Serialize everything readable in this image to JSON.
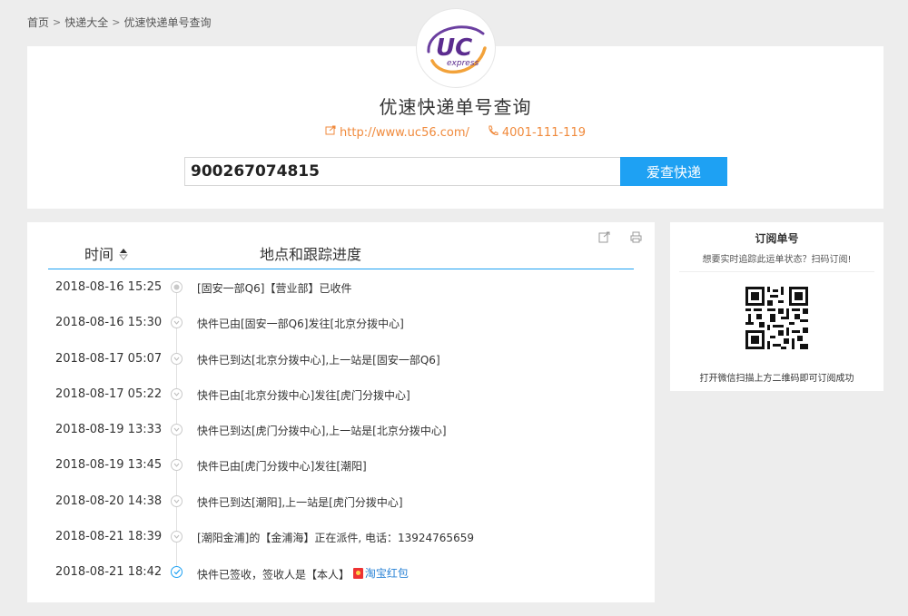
{
  "breadcrumb": {
    "home": "首页",
    "express_all": "快递大全",
    "current": "优速快递单号查询",
    "separator": ">"
  },
  "header": {
    "logo_text": "UC",
    "logo_sub": "express",
    "title": "优速快递单号查询",
    "website": "http://www.uc56.com/",
    "phone": "4001-111-119",
    "website_icon": "link-icon",
    "phone_icon": "phone-icon",
    "accent_color": "#f08a3c"
  },
  "search": {
    "value": "900267074815",
    "button_label": "爱查快递",
    "button_color": "#1ea1f3"
  },
  "result": {
    "col_time": "时间",
    "col_place": "地点和跟踪进度",
    "rows": [
      {
        "time": "2018-08-16 15:25",
        "desc": "[固安一部Q6]【营业部】已收件"
      },
      {
        "time": "2018-08-16 15:30",
        "desc": "快件已由[固安一部Q6]发往[北京分拨中心]"
      },
      {
        "time": "2018-08-17 05:07",
        "desc": "快件已到达[北京分拨中心],上一站是[固安一部Q6]"
      },
      {
        "time": "2018-08-17 05:22",
        "desc": "快件已由[北京分拨中心]发往[虎门分拨中心]"
      },
      {
        "time": "2018-08-19 13:33",
        "desc": "快件已到达[虎门分拨中心],上一站是[北京分拨中心]"
      },
      {
        "time": "2018-08-19 13:45",
        "desc": "快件已由[虎门分拨中心]发往[潮阳]"
      },
      {
        "time": "2018-08-20 14:38",
        "desc": "快件已到达[潮阳],上一站是[虎门分拨中心]"
      },
      {
        "time": "2018-08-21 18:39",
        "desc": "[潮阳金浦]的【金浦海】正在派件, 电话：13924765659"
      },
      {
        "time": "2018-08-21 18:42",
        "desc": "快件已签收，签收人是【本人】",
        "link": "淘宝红包"
      }
    ]
  },
  "subscribe": {
    "title": "订阅单号",
    "desc": "想要实时追踪此运单状态？扫码订阅!",
    "footer": "打开微信扫描上方二维码即可订阅成功"
  }
}
